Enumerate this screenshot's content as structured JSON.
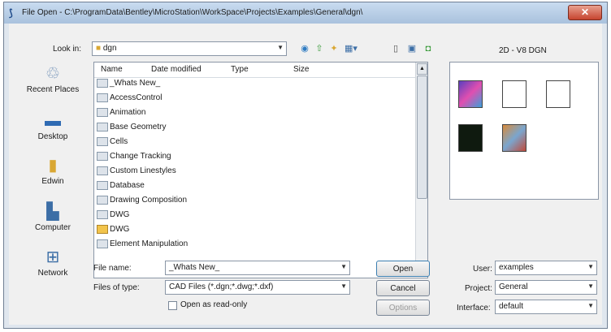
{
  "window": {
    "title": "File Open - C:\\ProgramData\\Bentley\\MicroStation\\WorkSpace\\Projects\\Examples\\General\\dgn\\",
    "close_label": "✕"
  },
  "toolbar": {
    "look_in_label": "Look in:",
    "look_in_value": "dgn",
    "preview_format": "2D - V8 DGN"
  },
  "places": [
    {
      "label": "Recent Places",
      "icon": "recent-places-icon"
    },
    {
      "label": "Desktop",
      "icon": "desktop-icon"
    },
    {
      "label": "Edwin",
      "icon": "user-folder-icon"
    },
    {
      "label": "Computer",
      "icon": "computer-icon"
    },
    {
      "label": "Network",
      "icon": "network-icon"
    }
  ],
  "columns": [
    "Name",
    "Date modified",
    "Type",
    "Size"
  ],
  "files": [
    {
      "name": "_Whats New_",
      "kind": "folder"
    },
    {
      "name": "AccessControl",
      "kind": "folder"
    },
    {
      "name": "Animation",
      "kind": "folder"
    },
    {
      "name": "Base Geometry",
      "kind": "folder"
    },
    {
      "name": "Cells",
      "kind": "folder"
    },
    {
      "name": "Change Tracking",
      "kind": "folder"
    },
    {
      "name": "Custom Linestyles",
      "kind": "folder"
    },
    {
      "name": "Database",
      "kind": "folder"
    },
    {
      "name": "Drawing Composition",
      "kind": "folder"
    },
    {
      "name": "DWG",
      "kind": "folder"
    },
    {
      "name": "DWG",
      "kind": "dwg"
    },
    {
      "name": "Element Manipulation",
      "kind": "folder"
    }
  ],
  "form": {
    "file_name_label": "File name:",
    "file_name_value": "_Whats New_",
    "file_type_label": "Files of type:",
    "file_type_value": "CAD Files (*.dgn;*.dwg;*.dxf)",
    "readonly_label": "Open as read-only"
  },
  "buttons": {
    "open": "Open",
    "cancel": "Cancel",
    "options": "Options"
  },
  "workspace": {
    "user_label": "User:",
    "user_value": "examples",
    "project_label": "Project:",
    "project_value": "General",
    "interface_label": "Interface:",
    "interface_value": "default"
  }
}
